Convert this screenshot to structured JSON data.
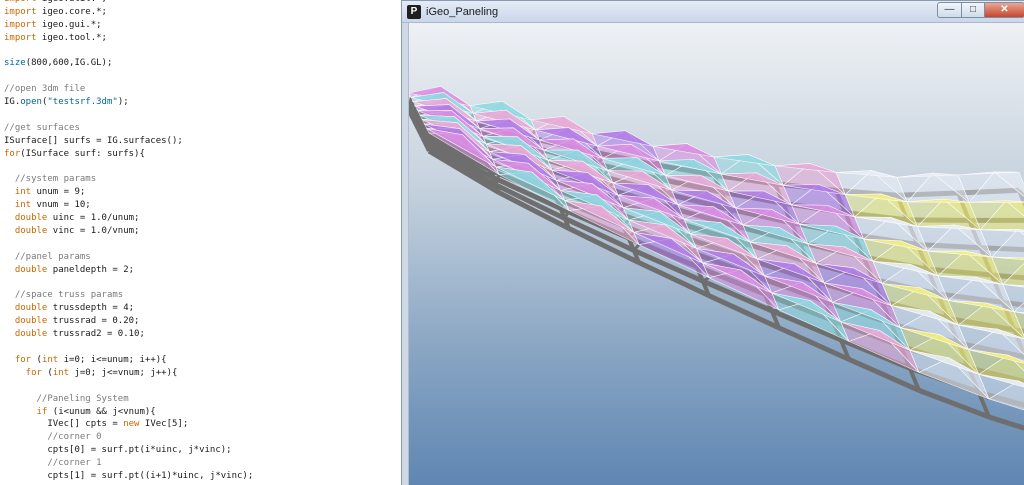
{
  "editor": {
    "lines": [
      [
        [
          "kw",
          "import"
        ],
        [
          "t",
          " igeo.util.*;"
        ]
      ],
      [
        [
          "kw",
          "import"
        ],
        [
          "t",
          " igeo.core.*;"
        ]
      ],
      [
        [
          "kw",
          "import"
        ],
        [
          "t",
          " igeo.gui.*;"
        ]
      ],
      [
        [
          "kw",
          "import"
        ],
        [
          "t",
          " igeo.tool.*;"
        ]
      ],
      [
        [
          "t",
          ""
        ]
      ],
      [
        [
          "fn",
          "size"
        ],
        [
          "t",
          "(800,600,IG.GL);"
        ]
      ],
      [
        [
          "t",
          ""
        ]
      ],
      [
        [
          "cm",
          "//open 3dm file"
        ]
      ],
      [
        [
          "t",
          "IG."
        ],
        [
          "fn",
          "open"
        ],
        [
          "t",
          "("
        ],
        [
          "str",
          "\"testsrf.3dm\""
        ],
        [
          "t",
          ");"
        ]
      ],
      [
        [
          "t",
          ""
        ]
      ],
      [
        [
          "cm",
          "//get surfaces"
        ]
      ],
      [
        [
          "t",
          "ISurface[] surfs = IG.surfaces();"
        ]
      ],
      [
        [
          "kw",
          "for"
        ],
        [
          "t",
          "(ISurface surf: surfs){"
        ]
      ],
      [
        [
          "t",
          ""
        ]
      ],
      [
        [
          "cm",
          "  //system params"
        ]
      ],
      [
        [
          "kw",
          "  int"
        ],
        [
          "t",
          " unum = 9;"
        ]
      ],
      [
        [
          "kw",
          "  int"
        ],
        [
          "t",
          " vnum = 10;"
        ]
      ],
      [
        [
          "kw",
          "  double"
        ],
        [
          "t",
          " uinc = 1.0/unum;"
        ]
      ],
      [
        [
          "kw",
          "  double"
        ],
        [
          "t",
          " vinc = 1.0/vnum;"
        ]
      ],
      [
        [
          "t",
          ""
        ]
      ],
      [
        [
          "cm",
          "  //panel params"
        ]
      ],
      [
        [
          "kw",
          "  double"
        ],
        [
          "t",
          " paneldepth = 2;"
        ]
      ],
      [
        [
          "t",
          ""
        ]
      ],
      [
        [
          "cm",
          "  //space truss params"
        ]
      ],
      [
        [
          "kw",
          "  double"
        ],
        [
          "t",
          " trussdepth = 4;"
        ]
      ],
      [
        [
          "kw",
          "  double"
        ],
        [
          "t",
          " trussrad = 0.20;"
        ]
      ],
      [
        [
          "kw",
          "  double"
        ],
        [
          "t",
          " trussrad2 = 0.10;"
        ]
      ],
      [
        [
          "t",
          ""
        ]
      ],
      [
        [
          "kw",
          "  for"
        ],
        [
          "t",
          " ("
        ],
        [
          "kw",
          "int"
        ],
        [
          "t",
          " i=0; i<=unum; i++){"
        ]
      ],
      [
        [
          "kw",
          "    for"
        ],
        [
          "t",
          " ("
        ],
        [
          "kw",
          "int"
        ],
        [
          "t",
          " j=0; j<=vnum; j++){"
        ]
      ],
      [
        [
          "t",
          ""
        ]
      ],
      [
        [
          "cm",
          "      //Paneling System"
        ]
      ],
      [
        [
          "kw",
          "      if"
        ],
        [
          "t",
          " (i<unum && j<vnum){"
        ]
      ],
      [
        [
          "t",
          "        IVec[] cpts = "
        ],
        [
          "kw",
          "new"
        ],
        [
          "t",
          " IVec[5];"
        ]
      ],
      [
        [
          "cm",
          "        //corner 0"
        ]
      ],
      [
        [
          "t",
          "        cpts[0] = surf.pt(i*uinc, j*vinc);"
        ]
      ],
      [
        [
          "cm",
          "        //corner 1"
        ]
      ],
      [
        [
          "t",
          "        cpts[1] = surf.pt((i+1)*uinc, j*vinc);"
        ]
      ]
    ]
  },
  "window": {
    "title": "iGeo_Paneling",
    "app_icon": "P",
    "minimize_symbol": "—",
    "maximize_symbol": "□",
    "close_symbol": "✕"
  },
  "viewport": {
    "content": "3d-space-truss-paneling",
    "colors": {
      "truss": "#6e6e6e",
      "panel_magenta": "#d98ee0",
      "panel_cyan": "#8fd8e0",
      "panel_pink": "#e9a8d6",
      "panel_yellow": "#f2ef7a",
      "panel_purple": "#b07be6",
      "panel_white": "#e8eef6"
    }
  }
}
